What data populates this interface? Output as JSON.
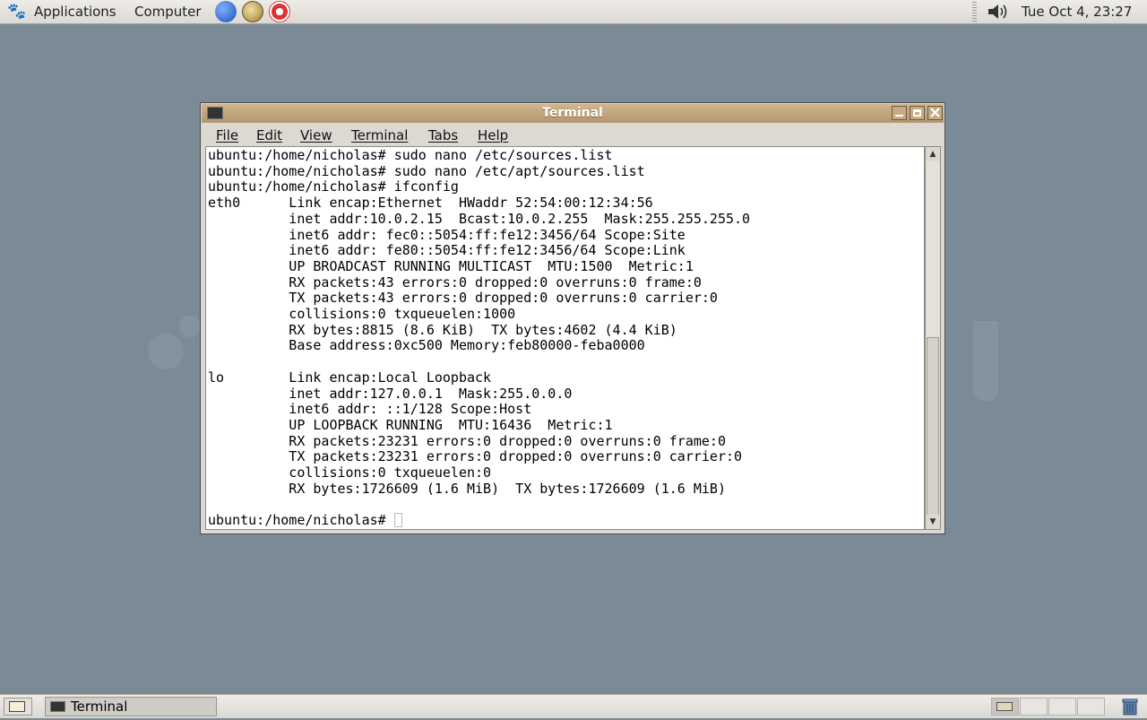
{
  "top_panel": {
    "menus": [
      "Applications",
      "Computer"
    ],
    "launchers": [
      "web-browser-icon",
      "email-client-icon",
      "help-icon"
    ],
    "volume_icon": "speaker-icon",
    "clock": "Tue Oct  4, 23:27"
  },
  "window": {
    "title": "Terminal",
    "menu": [
      "File",
      "Edit",
      "View",
      "Terminal",
      "Tabs",
      "Help"
    ],
    "terminal_lines": [
      "ubuntu:/home/nicholas# sudo nano /etc/sources.list",
      "ubuntu:/home/nicholas# sudo nano /etc/apt/sources.list",
      "ubuntu:/home/nicholas# ifconfig",
      "eth0      Link encap:Ethernet  HWaddr 52:54:00:12:34:56",
      "          inet addr:10.0.2.15  Bcast:10.0.2.255  Mask:255.255.255.0",
      "          inet6 addr: fec0::5054:ff:fe12:3456/64 Scope:Site",
      "          inet6 addr: fe80::5054:ff:fe12:3456/64 Scope:Link",
      "          UP BROADCAST RUNNING MULTICAST  MTU:1500  Metric:1",
      "          RX packets:43 errors:0 dropped:0 overruns:0 frame:0",
      "          TX packets:43 errors:0 dropped:0 overruns:0 carrier:0",
      "          collisions:0 txqueuelen:1000",
      "          RX bytes:8815 (8.6 KiB)  TX bytes:4602 (4.4 KiB)",
      "          Base address:0xc500 Memory:feb80000-feba0000",
      "",
      "lo        Link encap:Local Loopback",
      "          inet addr:127.0.0.1  Mask:255.0.0.0",
      "          inet6 addr: ::1/128 Scope:Host",
      "          UP LOOPBACK RUNNING  MTU:16436  Metric:1",
      "          RX packets:23231 errors:0 dropped:0 overruns:0 frame:0",
      "          TX packets:23231 errors:0 dropped:0 overruns:0 carrier:0",
      "          collisions:0 txqueuelen:0",
      "          RX bytes:1726609 (1.6 MiB)  TX bytes:1726609 (1.6 MiB)",
      ""
    ],
    "prompt": "ubuntu:/home/nicholas# "
  },
  "bottom_panel": {
    "task": "Terminal"
  }
}
